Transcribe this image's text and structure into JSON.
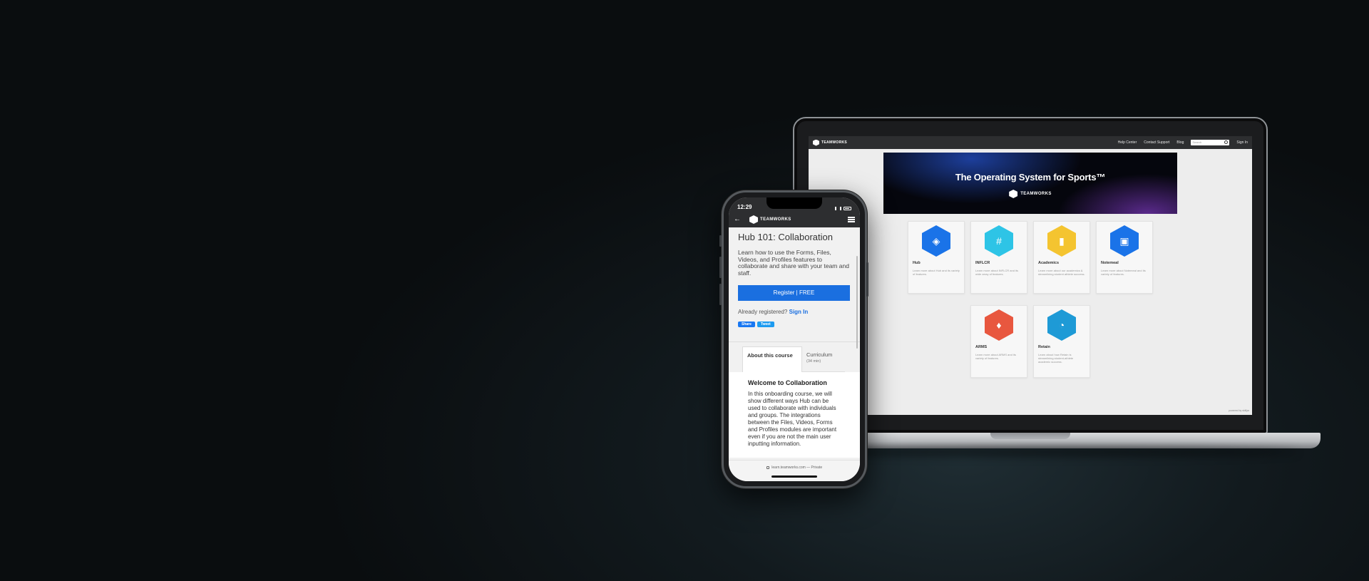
{
  "site": {
    "brand": "TEAMWORKS",
    "nav_links": [
      "Help Center",
      "Contact Support",
      "Blog"
    ],
    "search_placeholder": "Search",
    "sign_in": "Sign In",
    "hero_title": "The Operating System for Sports™",
    "hero_brand": "TEAMWORKS",
    "powered_by": "powered by skilljar",
    "cards": [
      {
        "name": "Hub",
        "desc": "Learn more about Hub and its variety of features.",
        "icon": "cube-icon",
        "color": "#1a73e8",
        "glyph": "◈"
      },
      {
        "name": "INFLCR",
        "desc": "Learn more about INFLCR and its wide array of features.",
        "icon": "hash-icon",
        "color": "#2ec4e6",
        "glyph": "#"
      },
      {
        "name": "Academics",
        "desc": "Learn more about our academics & streamlining student athlete success.",
        "icon": "bookmark-icon",
        "color": "#f4c430",
        "glyph": "▮"
      },
      {
        "name": "Notemeal",
        "desc": "Learn more about Notemeal and its variety of features.",
        "icon": "clipboard-icon",
        "color": "#1a73e8",
        "glyph": "▣"
      },
      {
        "name": "ARMS",
        "desc": "Learn more about ARMS and its variety of features.",
        "icon": "shield-icon",
        "color": "#e8573f",
        "glyph": "♦"
      },
      {
        "name": "Retain",
        "desc": "Learn about how Retain is streamlining student-athlete academic success.",
        "icon": "rss-icon",
        "color": "#1e9ad6",
        "glyph": "◔"
      }
    ]
  },
  "phone": {
    "time": "12:29",
    "brand": "TEAMWORKS",
    "course_title": "Hub 101: Collaboration",
    "course_desc": "Learn how to use the Forms, Files, Videos, and Profiles features to collaborate and share with your team and staff.",
    "register_label": "Register | FREE",
    "already_text": "Already registered?",
    "sign_in": "Sign In",
    "share_fb": "Share",
    "share_tw": "Tweet",
    "tab_about": "About this course",
    "tab_curriculum": "Curriculum",
    "tab_curriculum_sub": "(34 min)",
    "welcome": "Welcome to Collaboration",
    "panel_text": "In this onboarding course, we will show different ways Hub can be used to collaborate with individuals and groups. The integrations between the Files, Videos, Forms and Profiles modules are important even if you are not the main user inputting information.",
    "url": "learn.teamworks.com — Private"
  }
}
